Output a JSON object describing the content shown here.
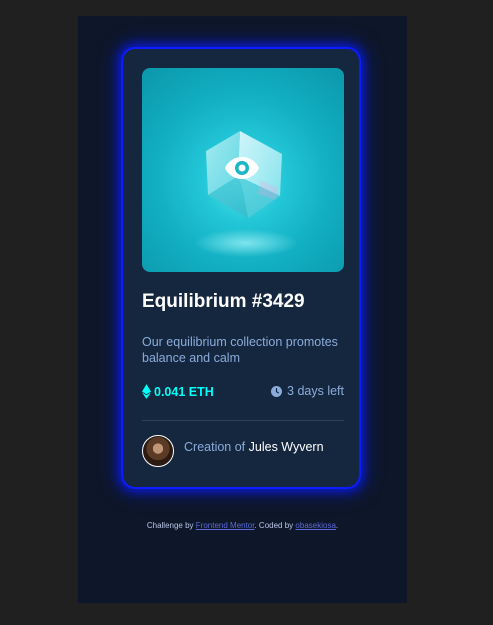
{
  "card": {
    "title": "Equilibrium #3429",
    "description": "Our equilibrium collection promotes balance and calm",
    "price": "0.041 ETH",
    "time_left": "3 days left",
    "creator_prefix": "Creation of",
    "creator_name": "Jules Wyvern"
  },
  "attribution": {
    "prefix": "Challenge by",
    "challenge_link": "Frontend Mentor",
    "middle": ". Coded by",
    "coder_link": "obasekiosa",
    "suffix": "."
  },
  "colors": {
    "page_bg": "#0e1729",
    "card_bg": "#15263f",
    "accent_cyan": "#00fff8",
    "soft_blue": "#8bacda",
    "glow_blue": "#0c1cff"
  },
  "icons": {
    "view": "eye-icon",
    "price": "ethereum-icon",
    "time": "clock-icon"
  }
}
